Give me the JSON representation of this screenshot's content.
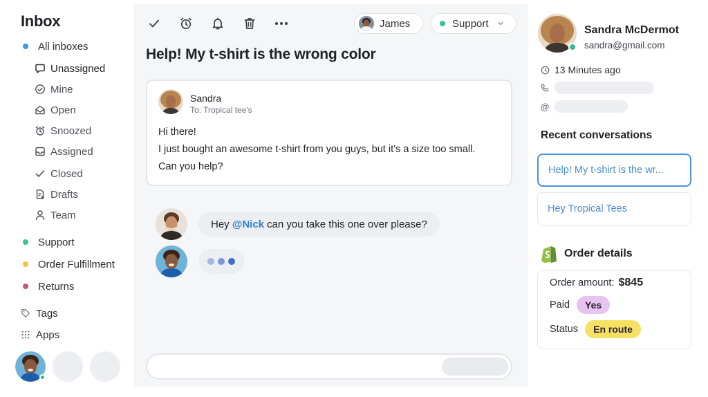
{
  "colors": {
    "all_inboxes_dot": "#3b9ae6",
    "support_dot": "#3fbf9a",
    "order_fulfillment_dot": "#f0c548",
    "returns_dot": "#c0587d",
    "mention": "#2f7fd3",
    "link": "#4a8fd6",
    "active_border": "#4d8fe0",
    "paid_badge": "#e7c3f2",
    "status_badge": "#f6e163",
    "shopify_green": "#95bf47",
    "online": "#3cb98d"
  },
  "sidebar": {
    "title": "Inbox",
    "all_inboxes": "All inboxes",
    "items": [
      {
        "label": "Unassigned",
        "icon": "message-square-icon"
      },
      {
        "label": "Mine",
        "icon": "check-circle-icon"
      },
      {
        "label": "Open",
        "icon": "envelope-open-icon"
      },
      {
        "label": "Snoozed",
        "icon": "alarm-clock-icon"
      },
      {
        "label": "Assigned",
        "icon": "inbox-tray-icon"
      },
      {
        "label": "Closed",
        "icon": "check-icon"
      },
      {
        "label": "Drafts",
        "icon": "draft-file-icon"
      },
      {
        "label": "Team",
        "icon": "user-icon"
      }
    ],
    "inboxes": [
      {
        "label": "Support"
      },
      {
        "label": "Order Fulfillment"
      },
      {
        "label": "Returns"
      }
    ],
    "tags": "Tags",
    "apps": "Apps"
  },
  "toolbar": {
    "icons": [
      "check-icon",
      "alarm-clock-icon",
      "bell-icon",
      "trash-icon",
      "more-horizontal-icon"
    ],
    "assignee": "James",
    "inbox": "Support"
  },
  "conversation": {
    "subject": "Help! My t-shirt is the wrong color",
    "message": {
      "from": "Sandra",
      "to": "To: Tropical tee's",
      "greeting": "Hi there!",
      "line1": "I just bought an awesome t-shirt from you guys, but it’s a size too small.",
      "line2": "Can you help?"
    },
    "comment": {
      "prefix": "Hey",
      "mention": "@Nick",
      "suffix": "can you take this one over please?"
    }
  },
  "contact": {
    "name": "Sandra McDermot",
    "email": "sandra@gmail.com",
    "last_seen": "13 Minutes ago",
    "recent_title": "Recent conversations",
    "recent": [
      "Help! My t-shirt is the wr...",
      "Hey Tropical Tees"
    ],
    "order_title": "Order details",
    "order_amount_label": "Order amount:",
    "order_amount": "$845",
    "paid_label": "Paid",
    "paid_value": "Yes",
    "status_label": "Status",
    "status_value": "En route"
  }
}
